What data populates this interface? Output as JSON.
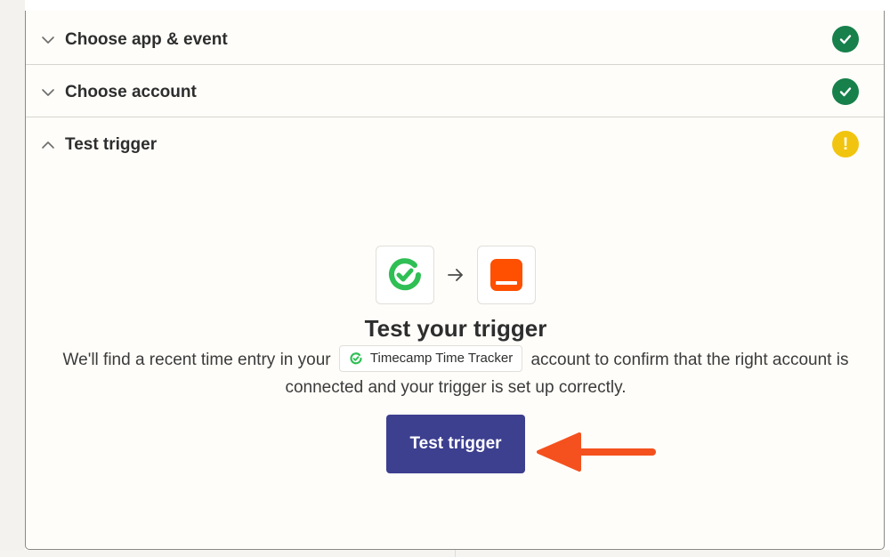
{
  "steps": [
    {
      "title": "Choose app & event",
      "expanded": false,
      "status": "complete"
    },
    {
      "title": "Choose account",
      "expanded": false,
      "status": "complete"
    },
    {
      "title": "Test trigger",
      "expanded": true,
      "status": "warning"
    }
  ],
  "status_warning_glyph": "!",
  "test": {
    "heading": "Test your trigger",
    "desc_before": "We'll find a recent time entry in your",
    "app_chip": "Timecamp Time Tracker",
    "desc_after": "account to confirm that the right account is connected and your trigger is set up correctly.",
    "button_label": "Test trigger"
  },
  "icons": {
    "collapsed": "chevron-down-icon",
    "expanded": "chevron-up-icon",
    "complete": "check-circle-icon",
    "warning": "exclamation-circle-icon",
    "source_app": "timecamp-logo-icon",
    "flow": "arrow-right-icon",
    "target_app": "zapier-app-icon",
    "annotation": "red-arrow-icon"
  },
  "colors": {
    "complete": "#17804b",
    "warning": "#f1c40f",
    "button": "#3d3f8f",
    "timecamp": "#2fbf55",
    "target_app": "#ff4f00",
    "annotation": "#f4511e"
  }
}
